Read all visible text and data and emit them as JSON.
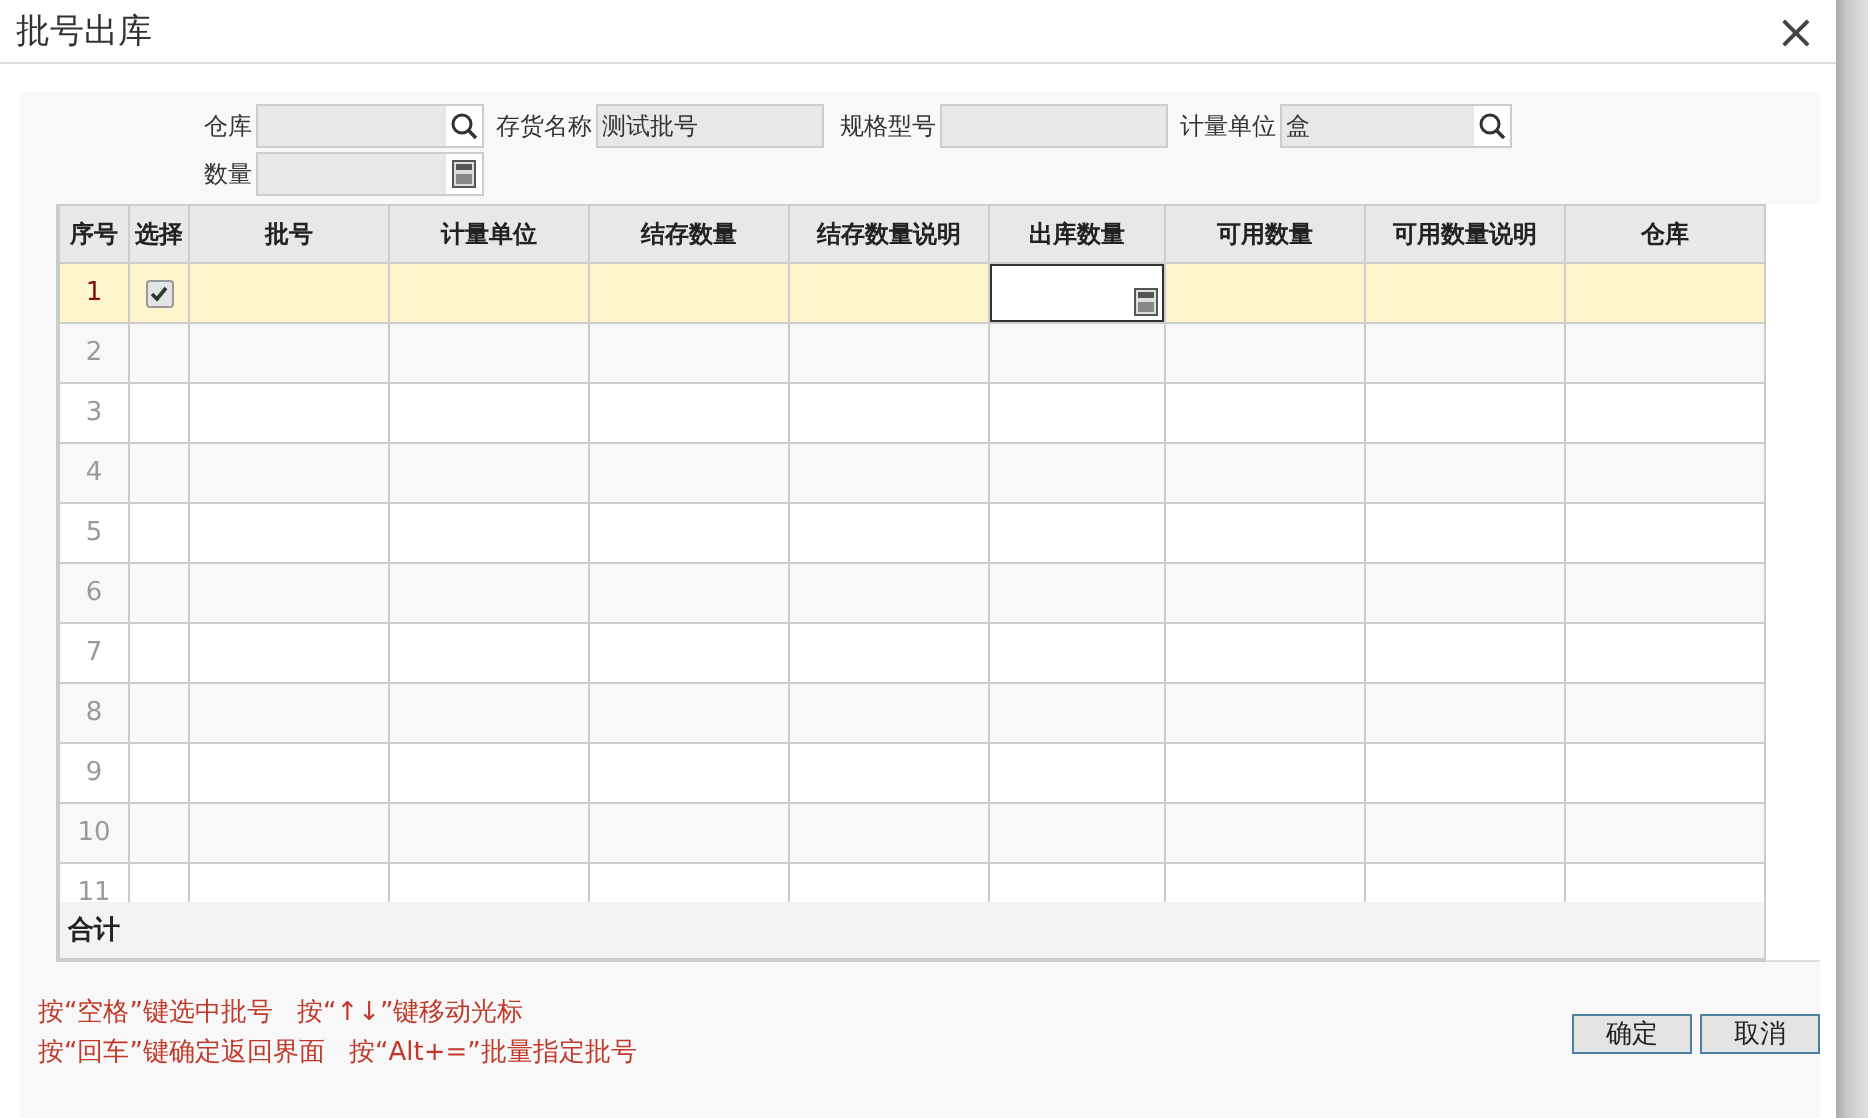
{
  "window": {
    "title": "批号出库",
    "close": "×"
  },
  "form": {
    "row1": [
      {
        "label": "仓库",
        "kind": "lookup"
      },
      {
        "label": "存货名称",
        "value": "测试批号",
        "kind": "text"
      },
      {
        "label": "规格型号",
        "kind": "text"
      },
      {
        "label": "计量单位",
        "value": "盒",
        "kind": "lookup"
      }
    ],
    "row2": [
      {
        "label": "数量",
        "kind": "number"
      }
    ]
  },
  "table": {
    "columns": [
      {
        "label": "序号",
        "kind": "index"
      },
      {
        "label": "选择",
        "kind": "select"
      },
      {
        "label": "批号",
        "kind": "text"
      },
      {
        "label": "计量单位",
        "kind": "text"
      },
      {
        "label": "结存数量",
        "kind": "text"
      },
      {
        "label": "结存数量说明",
        "kind": "text"
      },
      {
        "label": "出库数量",
        "kind": "input"
      },
      {
        "label": "可用数量",
        "kind": "text"
      },
      {
        "label": "可用数量说明",
        "kind": "text"
      },
      {
        "label": "仓库",
        "kind": "text"
      }
    ],
    "rows": [
      {
        "index": "1",
        "selected": true,
        "checked": true,
        "editing": true
      },
      {
        "index": "2",
        "selected": false,
        "checked": false,
        "editing": false
      },
      {
        "index": "3",
        "selected": false,
        "checked": false,
        "editing": false
      },
      {
        "index": "4",
        "selected": false,
        "checked": false,
        "editing": false
      },
      {
        "index": "5",
        "selected": false,
        "checked": false,
        "editing": false
      },
      {
        "index": "6",
        "selected": false,
        "checked": false,
        "editing": false
      },
      {
        "index": "7",
        "selected": false,
        "checked": false,
        "editing": false
      },
      {
        "index": "8",
        "selected": false,
        "checked": false,
        "editing": false
      },
      {
        "index": "9",
        "selected": false,
        "checked": false,
        "editing": false
      },
      {
        "index": "10",
        "selected": false,
        "checked": false,
        "editing": false
      },
      {
        "index": "11",
        "selected": false,
        "checked": false,
        "editing": false
      }
    ],
    "total_label": "合计"
  },
  "hints": [
    [
      "按“空格”键选中批号",
      "按“↑↓”键移动光标"
    ],
    [
      "按“回车”键确定返回界面",
      "按“Alt+=”批量指定批号"
    ]
  ],
  "buttons": [
    "确定",
    "取消"
  ]
}
